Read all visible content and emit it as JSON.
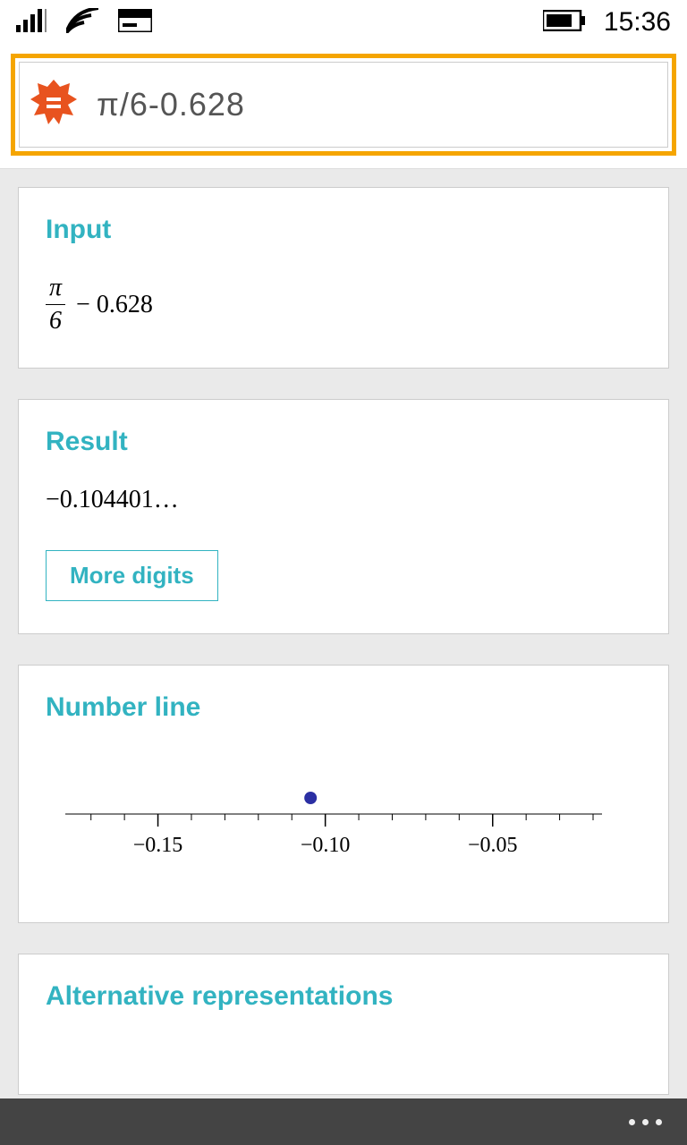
{
  "status": {
    "time": "15:36"
  },
  "search": {
    "query": "π/6-0.628"
  },
  "sections": {
    "input": {
      "title": "Input",
      "numerator": "π",
      "denominator": "6",
      "tail": " − 0.628"
    },
    "result": {
      "title": "Result",
      "value": "−0.104401…",
      "more_label": "More digits"
    },
    "numberline": {
      "title": "Number line"
    },
    "altrep": {
      "title": "Alternative representations"
    }
  },
  "chart_data": {
    "type": "scatter",
    "title": "Number line",
    "xlabel": "",
    "ylabel": "",
    "x_ticks": [
      -0.15,
      -0.1,
      -0.05
    ],
    "xlim": [
      -0.175,
      -0.02
    ],
    "points": [
      {
        "x": -0.1044,
        "y": 0
      }
    ]
  }
}
